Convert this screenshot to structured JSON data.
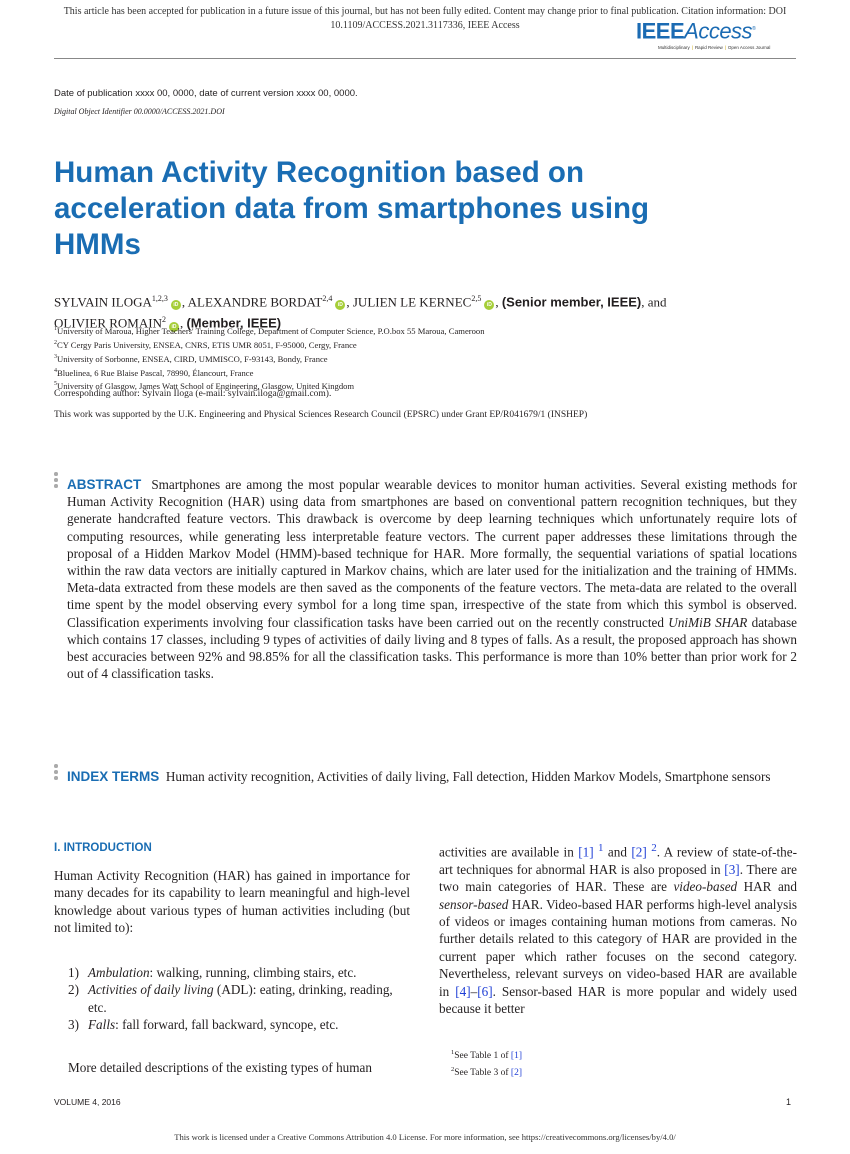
{
  "header": {
    "notice_line1": "This article has been accepted for publication in a future issue of this journal, but has not been fully edited. Content may change prior to final publication. Citation information: DOI",
    "notice_line2": "10.1109/ACCESS.2021.3117336, IEEE Access",
    "logo_bold": "IEEE",
    "logo_light": "Access",
    "logo_tm": "®",
    "logo_tagline": [
      "Multidisciplinary",
      "Rapid Review",
      "Open Access Journal"
    ]
  },
  "meta": {
    "publication_date": "Date of publication xxxx 00, 0000, date of current version xxxx 00, 0000.",
    "doi": "Digital Object Identifier 00.0000/ACCESS.2021.DOI"
  },
  "title": "Human Activity Recognition based on acceleration data from smartphones using HMMs",
  "authors": [
    {
      "name": "SYLVAIN ILOGA",
      "affil": "1,2,3",
      "orcid": true
    },
    {
      "name": "ALEXANDRE BORDAT",
      "affil": "2,4",
      "orcid": true
    },
    {
      "name": "JULIEN LE KERNEC",
      "affil": "2,5",
      "orcid": true,
      "grade": "(Senior member, IEEE)"
    },
    {
      "name": "OLIVIER ROMAIN",
      "affil": "2",
      "orcid": true,
      "grade": "(Member, IEEE)"
    }
  ],
  "authors_and": "and",
  "orcid_label": "iD",
  "affiliations": [
    {
      "num": "1",
      "text": "University of Maroua, Higher Teachers' Training College, Department of Computer Science, P.O.box 55 Maroua, Cameroon"
    },
    {
      "num": "2",
      "text": "CY Cergy Paris University, ENSEA, CNRS, ETIS UMR 8051, F-95000, Cergy, France"
    },
    {
      "num": "3",
      "text": "University of Sorbonne, ENSEA, CIRD, UMMISCO, F-93143, Bondy, France"
    },
    {
      "num": "4",
      "text": "Bluelinea, 6 Rue Blaise Pascal, 78990, Élancourt, France"
    },
    {
      "num": "5",
      "text": "University of Glasgow, James Watt School of Engineering, Glasgow, United Kingdom"
    }
  ],
  "corresponding": "Corresponding author: Sylvain Iloga (e-mail: sylvain.iloga@gmail.com).",
  "support": "This work was supported by the U.K. Engineering and Physical Sciences Research Council (EPSRC) under Grant EP/R041679/1 (INSHEP)",
  "abstract": {
    "label": "ABSTRACT",
    "text_before_italic": "Smartphones are among the most popular wearable devices to monitor human activities. Several existing methods for Human Activity Recognition (HAR) using data from smartphones are based on conventional pattern recognition techniques, but they generate handcrafted feature vectors. This drawback is overcome by deep learning techniques which unfortunately require lots of computing resources, while generating less interpretable feature vectors. The current paper addresses these limitations through the proposal of a Hidden Markov Model (HMM)-based technique for HAR. More formally, the sequential variations of spatial locations within the raw data vectors are initially captured in Markov chains, which are later used for the initialization and the training of HMMs. Meta-data extracted from these models are then saved as the components of the feature vectors. The meta-data are related to the overall time spent by the model observing every symbol for a long time span, irrespective of the state from which this symbol is observed. Classification experiments involving four classification tasks have been carried out on the recently constructed",
    "italic": "UniMiB SHAR",
    "text_after_italic": "database which contains 17 classes, including 9 types of activities of daily living and 8 types of falls. As a result, the proposed approach has shown best accuracies between 92% and 98.85% for all the classification tasks. This performance is more than 10% better than prior work for 2 out of 4 classification tasks."
  },
  "index_terms": {
    "label": "INDEX TERMS",
    "text": "Human activity recognition, Activities of daily living, Fall detection, Hidden Markov Models, Smartphone sensors"
  },
  "introduction": {
    "heading": "I. INTRODUCTION",
    "para1": "Human Activity Recognition (HAR) has gained in importance for many decades for its capability to learn meaningful and high-level knowledge about various types of human activities including (but not limited to):",
    "list": [
      {
        "num": "1)",
        "term": "Ambulation",
        "rest": ": walking, running, climbing stairs, etc."
      },
      {
        "num": "2)",
        "term": "Activities of daily living",
        "rest": " (ADL): eating, drinking, reading, etc."
      },
      {
        "num": "3)",
        "term": "Falls",
        "rest": ": fall forward, fall backward, syncope, etc."
      }
    ],
    "para2_start": "More detailed descriptions of the existing types of human",
    "right": {
      "s1": "activities are available in ",
      "r1": "[1]",
      "fn1": "1",
      "s2": " and ",
      "r2": "[2]",
      "fn2": "2",
      "s3": ". A review of state-of-the-art techniques for abnormal HAR is also proposed in ",
      "r3": "[3]",
      "s4": ". There are two main categories of HAR. These are ",
      "i1": "video-based",
      "s5": " HAR and ",
      "i2": "sensor-based",
      "s6": " HAR. Video-based HAR performs high-level analysis of videos or images containing human motions from cameras. No further details related to this category of HAR are provided in the current paper which rather focuses on the second category. Nevertheless, relevant surveys on video-based HAR are available in ",
      "r4": "[4]",
      "dash": "–",
      "r6": "[6]",
      "s7": ". Sensor-based HAR is more popular and widely used because it better"
    }
  },
  "footnotes": [
    {
      "num": "1",
      "text": "See Table 1 of ",
      "ref": "[1]"
    },
    {
      "num": "2",
      "text": "See Table 3 of ",
      "ref": "[2]"
    }
  ],
  "footer": {
    "volume": "VOLUME 4, 2016",
    "page": "1",
    "license": "This work is licensed under a Creative Commons Attribution 4.0 License. For more information, see https://creativecommons.org/licenses/by/4.0/"
  }
}
